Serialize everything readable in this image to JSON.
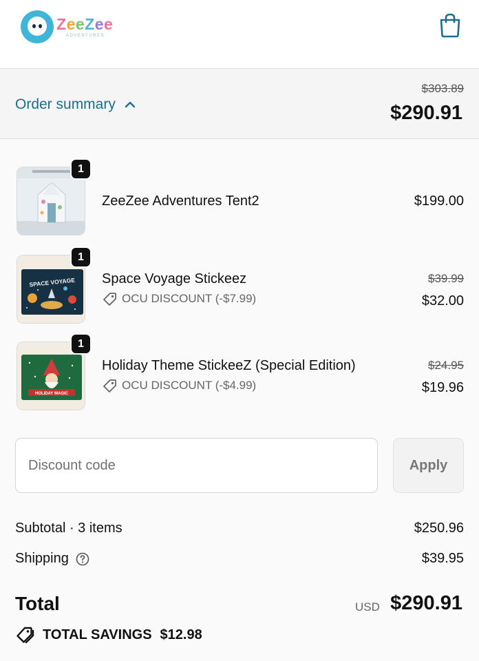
{
  "header": {
    "logo_word": "ZeeZee",
    "logo_sub": "ADVENTURES",
    "cart_icon": "shopping-bag-icon"
  },
  "summary": {
    "toggle_label": "Order summary",
    "original_total": "$303.89",
    "total": "$290.91"
  },
  "items": [
    {
      "qty": "1",
      "name": "ZeeZee Adventures Tent2",
      "price": "$199.00"
    },
    {
      "qty": "1",
      "name": "Space Voyage Stickeez",
      "discount": "OCU DISCOUNT (-$7.99)",
      "original_price": "$39.99",
      "price": "$32.00",
      "thumb_text": "SPACE VOYAGE"
    },
    {
      "qty": "1",
      "name": "Holiday Theme StickeeZ (Special Edition)",
      "discount": "OCU DISCOUNT (-$4.99)",
      "original_price": "$24.95",
      "price": "$19.96",
      "thumb_text": "HOLIDAY MAGIC"
    }
  ],
  "discount": {
    "placeholder": "Discount code",
    "apply_label": "Apply"
  },
  "totals": {
    "subtotal_label": "Subtotal · 3 items",
    "subtotal": "$250.96",
    "shipping_label": "Shipping",
    "shipping": "$39.95",
    "total_label": "Total",
    "currency": "USD",
    "total": "$290.91",
    "savings_label": "TOTAL SAVINGS",
    "savings": "$12.98"
  },
  "colors": {
    "accent": "#1a6f8a",
    "summary_bg": "#f5f5f5"
  }
}
